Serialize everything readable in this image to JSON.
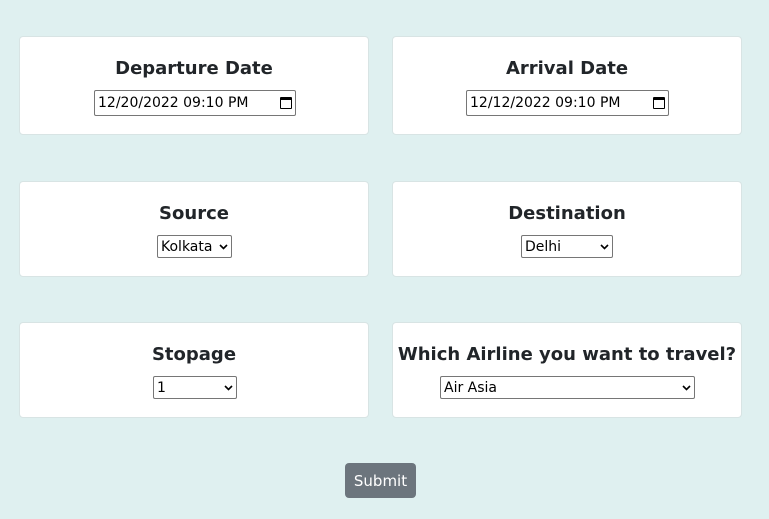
{
  "departure": {
    "label": "Departure Date",
    "value": "12/20/2022 09:10 PM",
    "icon": "calendar-icon"
  },
  "arrival": {
    "label": "Arrival Date",
    "value": "12/12/2022 09:10 PM",
    "icon": "calendar-icon"
  },
  "source": {
    "label": "Source",
    "selected": "Kolkata",
    "icon": "chevron-down-icon"
  },
  "destination": {
    "label": "Destination",
    "selected": "Delhi",
    "icon": "chevron-down-icon"
  },
  "stopage": {
    "label": "Stopage",
    "selected": "1",
    "icon": "chevron-down-icon"
  },
  "airline": {
    "label": "Which Airline you want to travel?",
    "selected": "Air Asia",
    "icon": "chevron-down-icon"
  },
  "submit": {
    "label": "Submit"
  },
  "colors": {
    "page_background": "#dff0f0",
    "card_background": "#ffffff",
    "submit_button": "#6c757d"
  }
}
